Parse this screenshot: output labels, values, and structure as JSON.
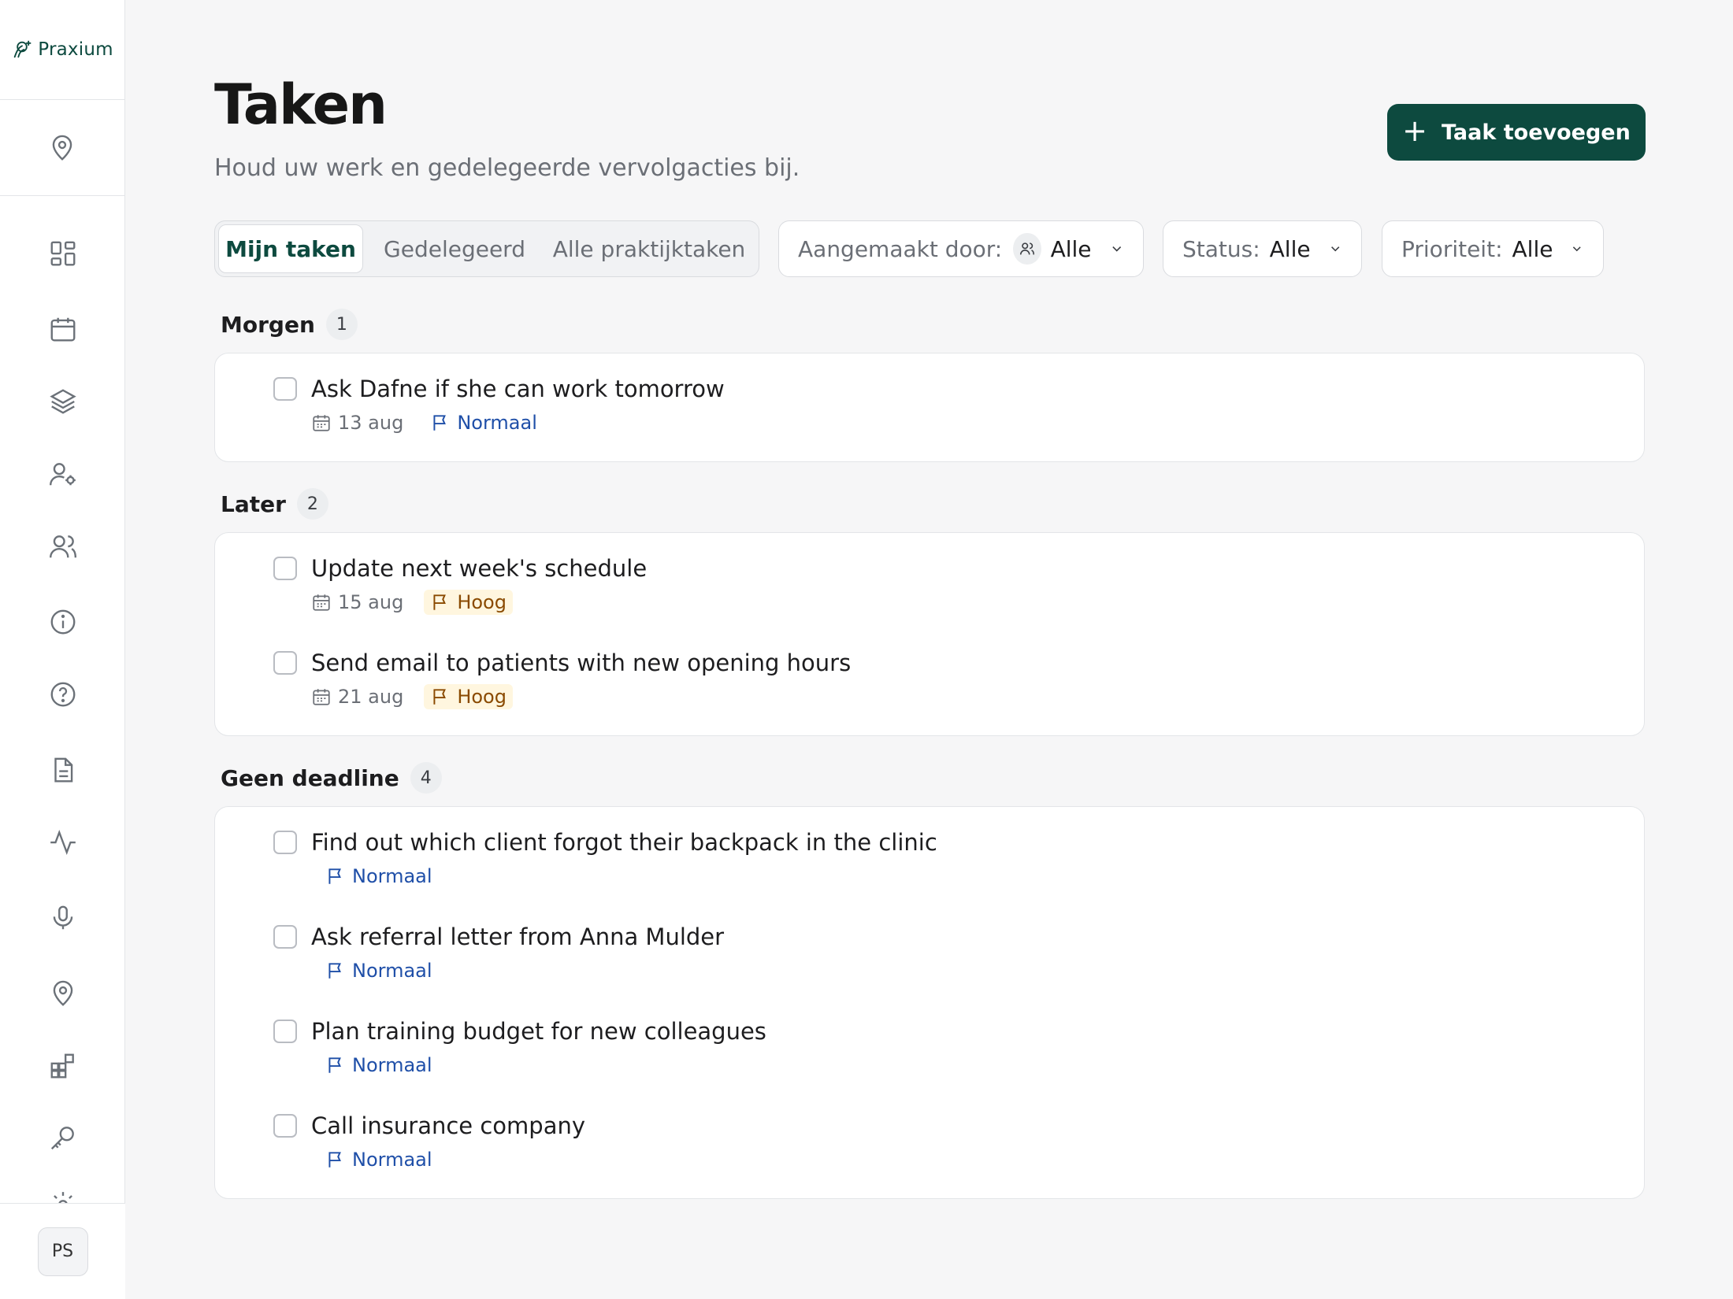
{
  "brand": {
    "name": "Praxium"
  },
  "header": {
    "title": "Taken",
    "subtitle": "Houd uw werk en gedelegeerde vervolgacties bij.",
    "add_button": "Taak toevoegen"
  },
  "tabs": [
    "Mijn taken",
    "Gedelegeerd",
    "Alle praktijktaken"
  ],
  "filters": {
    "created_by": {
      "label": "Aangemaakt door:",
      "value": "Alle"
    },
    "status": {
      "label": "Status:",
      "value": "Alle"
    },
    "priority": {
      "label": "Prioriteit:",
      "value": "Alle"
    }
  },
  "groups": [
    {
      "label": "Morgen",
      "count": "1",
      "tasks": [
        {
          "title": "Ask Dafne if she can work tomorrow",
          "date": "13 aug",
          "priority": "Normaal"
        }
      ]
    },
    {
      "label": "Later",
      "count": "2",
      "tasks": [
        {
          "title": "Update next week's schedule",
          "date": "15 aug",
          "priority": "Hoog"
        },
        {
          "title": "Send email to patients with new opening hours",
          "date": "21 aug",
          "priority": "Hoog"
        }
      ]
    },
    {
      "label": "Geen deadline",
      "count": "4",
      "tasks": [
        {
          "title": "Find out which client forgot their backpack in the clinic",
          "priority": "Normaal"
        },
        {
          "title": "Ask referral letter from Anna Mulder",
          "priority": "Normaal"
        },
        {
          "title": "Plan training budget for new colleagues",
          "priority": "Normaal"
        },
        {
          "title": "Call insurance company",
          "priority": "Normaal"
        }
      ]
    }
  ],
  "user": {
    "initials": "PS"
  },
  "sidebar_icons": [
    "location-icon",
    "dashboard-icon",
    "calendar-icon",
    "layers-icon",
    "user-settings-icon",
    "users-icon",
    "info-icon",
    "help-icon",
    "document-icon",
    "activity-icon",
    "microphone-icon",
    "location-icon",
    "widgets-icon",
    "key-icon",
    "settings-icon"
  ],
  "colors": {
    "brand": "#0d4a3f",
    "priority_normal": "#1f4fa8",
    "priority_high": "#8a4a00",
    "priority_high_bg": "#fff6df"
  }
}
